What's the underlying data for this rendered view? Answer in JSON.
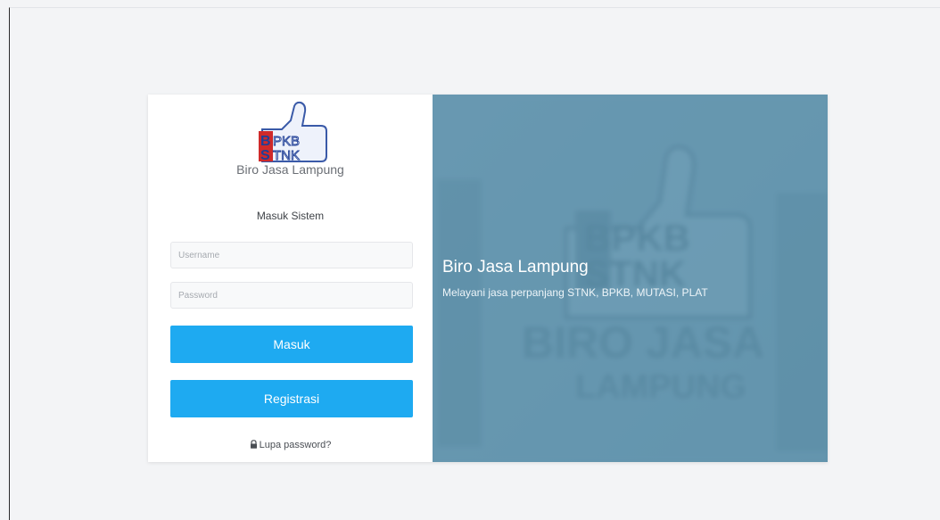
{
  "login": {
    "logo_text": "BPKB STNK",
    "brand_name": "Biro Jasa Lampung",
    "form_title": "Masuk Sistem",
    "username_placeholder": "Username",
    "password_placeholder": "Password",
    "login_button": "Masuk",
    "register_button": "Registrasi",
    "forgot_link": "Lupa password?"
  },
  "hero": {
    "title": "Biro Jasa Lampung",
    "subtitle": "Melayani jasa perpanjang STNK, BPKB, MUTASI, PLAT",
    "watermark_line1": "BIRO JASA",
    "watermark_line2": "LAMPUNG"
  },
  "colors": {
    "primary_button": "#1eaaf1",
    "hero_background": "#6496ae",
    "page_background": "#f3f4f6"
  },
  "icons": {
    "forgot": "lock-icon",
    "logo": "thumbs-up-logo"
  }
}
